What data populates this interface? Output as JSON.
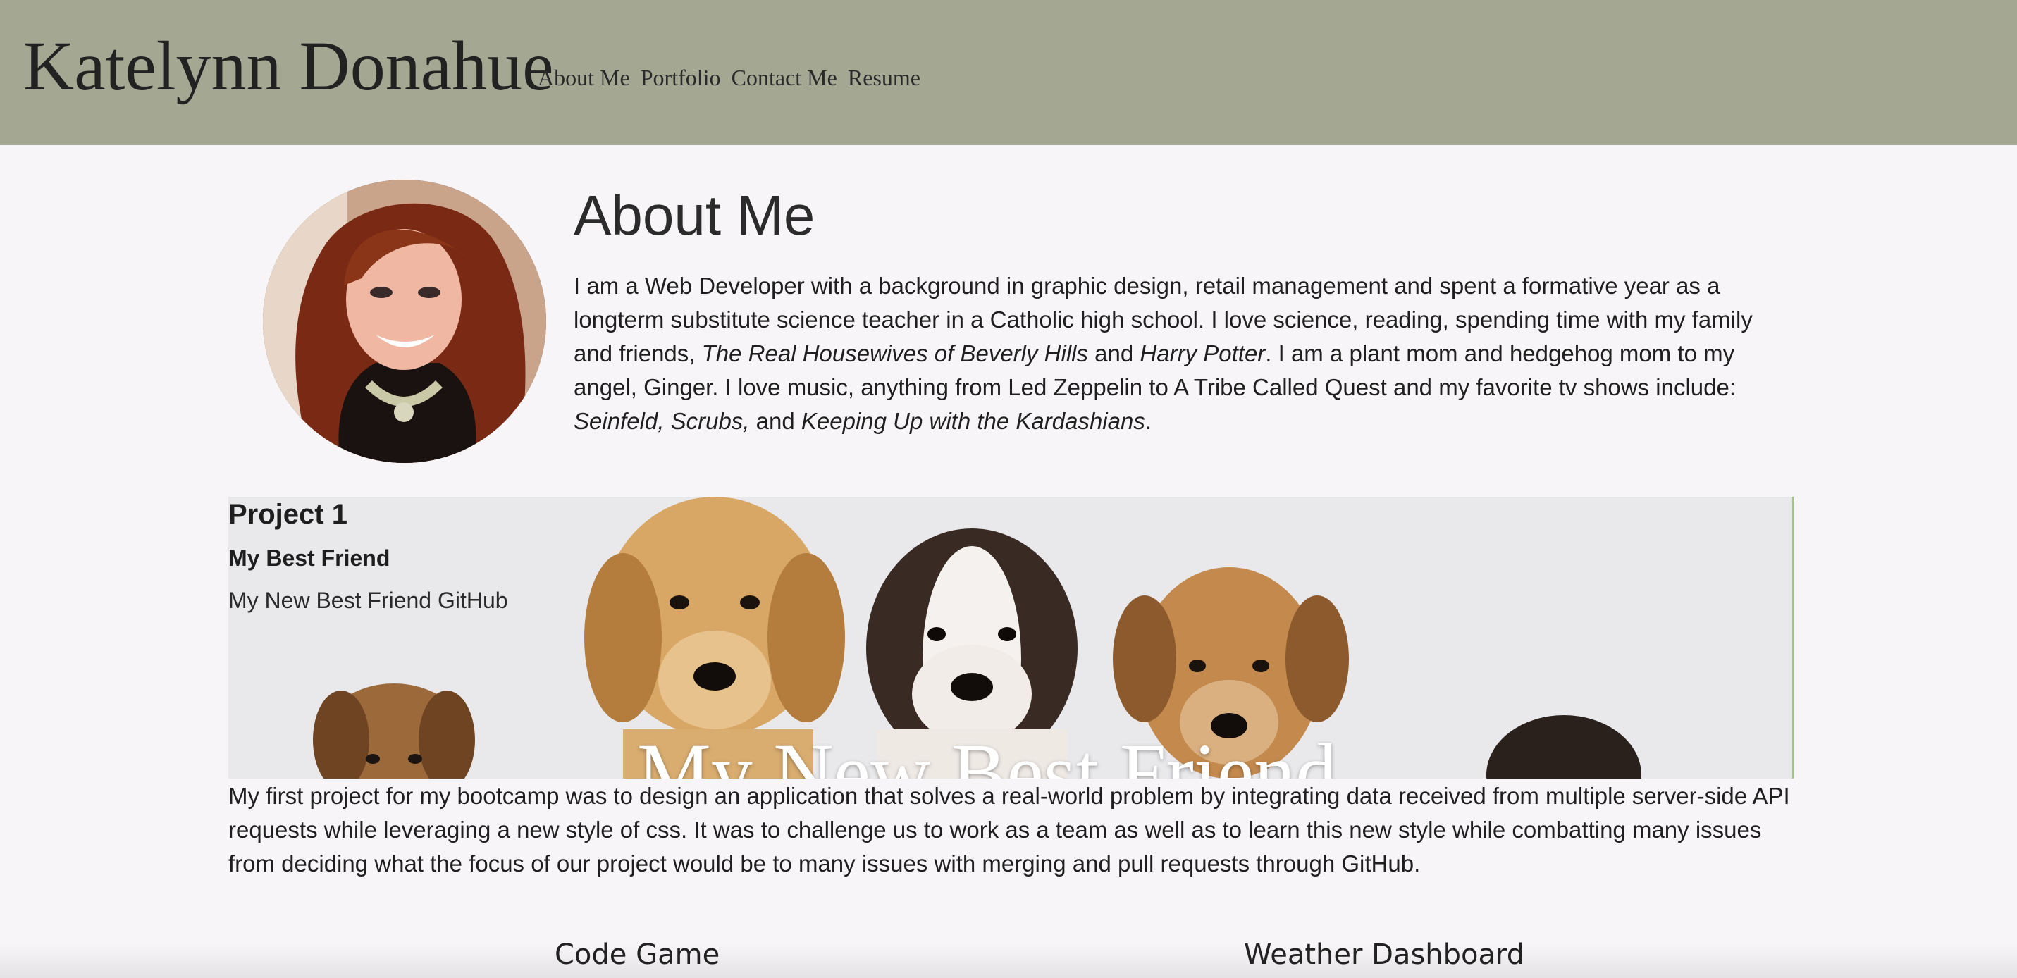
{
  "header": {
    "brand": "Katelynn Donahue",
    "nav": [
      "About Me",
      "Portfolio",
      "Contact Me",
      "Resume"
    ],
    "background_color": "#a4a893"
  },
  "about": {
    "title": "About Me",
    "paragraph_parts": [
      "I am a Web Developer with a background in graphic design, retail management and spent a formative year as a longterm substitute science teacher in a Catholic high school. I love science, reading, spending time with my family and friends, ",
      "The Real Housewives of Beverly Hills",
      " and ",
      "Harry Potter",
      ". I am a plant mom and hedgehog mom to my angel, Ginger. I love music, anything from Led Zeppelin to A Tribe Called Quest and my favorite tv shows include: ",
      "Seinfeld, Scrubs,",
      " and ",
      "Keeping Up with the Kardashians",
      "."
    ]
  },
  "project": {
    "number": "Project 1",
    "name": "My Best Friend",
    "link": "My New Best Friend GitHub",
    "image_caption": "My New Best Friend",
    "description": "My first project for my bootcamp was to design an application that solves a real-world problem by integrating data received from multiple server-side API requests while leveraging a new style of css. It was to challenge us to work as a team as well as to learn this new style while combatting many issues from deciding what the focus of our project would be to many issues with merging and pull requests through GitHub."
  },
  "cards": [
    "Code Game",
    "Weather Dashboard"
  ]
}
